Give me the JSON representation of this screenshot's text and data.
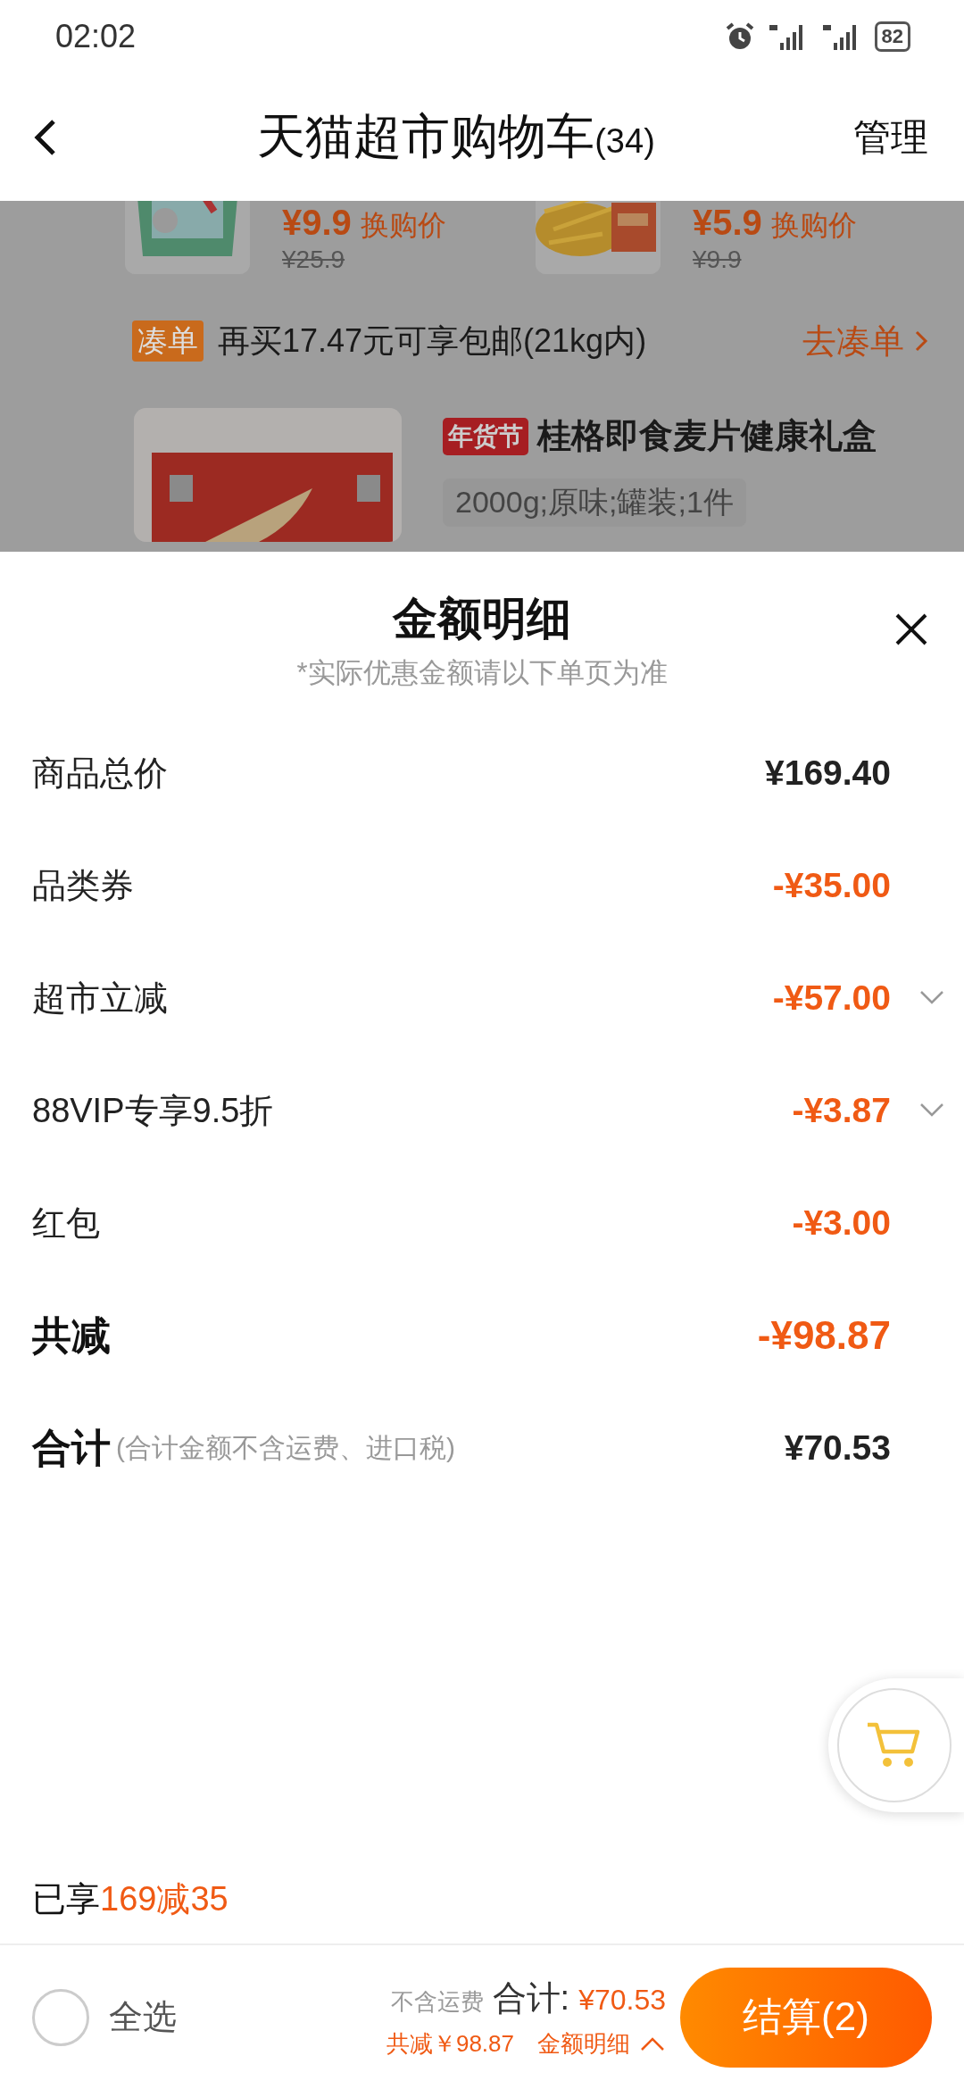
{
  "status_bar": {
    "time": "02:02",
    "battery": "82"
  },
  "header": {
    "title": "天猫超市购物车",
    "count": "(34)",
    "action": "管理"
  },
  "background": {
    "swap_items": [
      {
        "price": "¥9.9",
        "tag": "换购价",
        "original_price": "¥25.9"
      },
      {
        "price": "¥5.9",
        "tag": "换购价",
        "original_price": "¥9.9"
      }
    ],
    "bundle_bar": {
      "badge": "凑单",
      "text": "再买17.47元可享包邮(21kg内)",
      "link": "去凑单"
    },
    "product": {
      "badge": "年货节",
      "name": "桂格即食麦片健康礼盒",
      "sku": "2000g;原味;罐装;1件"
    }
  },
  "sheet": {
    "title": "金额明细",
    "note": "*实际优惠金额请以下单页为准",
    "rows": [
      {
        "kind": "item",
        "label": "商品总价",
        "value": "¥169.40",
        "discount": false,
        "expandable": false
      },
      {
        "kind": "item",
        "label": "品类券",
        "value": "-¥35.00",
        "discount": true,
        "expandable": false
      },
      {
        "kind": "item",
        "label": "超市立减",
        "value": "-¥57.00",
        "discount": true,
        "expandable": true
      },
      {
        "kind": "item",
        "label": "88VIP专享9.5折",
        "value": "-¥3.87",
        "discount": true,
        "expandable": true
      },
      {
        "kind": "item",
        "label": "红包",
        "value": "-¥3.00",
        "discount": true,
        "expandable": false
      },
      {
        "kind": "subtotal",
        "label": "共减",
        "value": "-¥98.87",
        "discount": true,
        "expandable": false
      },
      {
        "kind": "total",
        "label": "合计",
        "note": "(合计金额不含运费、进口税)",
        "value": "¥70.53",
        "discount": false,
        "expandable": false
      }
    ]
  },
  "promo": {
    "prefix": "已享",
    "highlight": "169减35"
  },
  "bottom_bar": {
    "select_all": {
      "label": "全选",
      "checked": false
    },
    "shipping_note": "不含运费",
    "total_label": "合计:",
    "total_value": "¥70.53",
    "savings": "共减￥98.87",
    "details_link": "金额明细",
    "checkout": "结算(2)"
  }
}
